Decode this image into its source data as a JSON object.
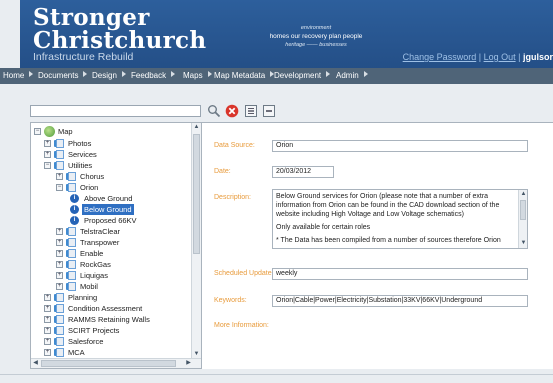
{
  "header": {
    "title_line1": "Stronger",
    "title_line2": "Christchurch",
    "subtitle": "Infrastructure Rebuild",
    "tagline_top": "environment",
    "tagline_mid": "homes  our recovery plan  people",
    "tagline_bot": "heritage —— businesses",
    "change_password": "Change Password",
    "separator": "|",
    "log_out": "Log Out",
    "user": "jgulsor"
  },
  "nav": {
    "items": [
      {
        "label": "Home"
      },
      {
        "label": "Documents"
      },
      {
        "label": "Design"
      },
      {
        "label": "Feedback"
      },
      {
        "label": "Maps"
      },
      {
        "label": "Map Metadata"
      },
      {
        "label": "Development"
      },
      {
        "label": "Admin"
      }
    ]
  },
  "toolbar": {
    "search_value": "",
    "icons": [
      "magnifier-icon",
      "clear-icon",
      "expand-all-icon",
      "collapse-all-icon"
    ]
  },
  "tree": {
    "items": [
      {
        "label": "Map",
        "expander": "−"
      },
      {
        "label": "Photos",
        "expander": "+"
      },
      {
        "label": "Services",
        "expander": "+"
      },
      {
        "label": "Utilities",
        "expander": "−"
      },
      {
        "label": "Chorus",
        "expander": "+"
      },
      {
        "label": "Orion",
        "expander": "−"
      },
      {
        "label": "Above Ground"
      },
      {
        "label": "Below Ground",
        "selected": true
      },
      {
        "label": "Proposed 66KV"
      },
      {
        "label": "TelstraClear",
        "expander": "+"
      },
      {
        "label": "Transpower",
        "expander": "+"
      },
      {
        "label": "Enable",
        "expander": "+"
      },
      {
        "label": "RockGas",
        "expander": "+"
      },
      {
        "label": "Liquigas",
        "expander": "+"
      },
      {
        "label": "Mobil",
        "expander": "+"
      },
      {
        "label": "Planning",
        "expander": "+"
      },
      {
        "label": "Condition Assessment",
        "expander": "+"
      },
      {
        "label": "RAMMS Retaining Walls",
        "expander": "+"
      },
      {
        "label": "SCIRT Projects",
        "expander": "+"
      },
      {
        "label": "Salesforce",
        "expander": "+"
      },
      {
        "label": "MCA",
        "expander": "+"
      }
    ]
  },
  "details": {
    "data_source_label": "Data Source:",
    "data_source": "Orion",
    "date_label": "Date:",
    "date": "20/03/2012",
    "description_label": "Description:",
    "description_p1": "Below Ground services for Orion (please note that a number of extra information from Orion can be found in the CAD download section of the website including High Voltage and Low Voltage schematics)",
    "description_p2": "Only available for certain roles",
    "description_p3": "* The Data has been compiled from a number of sources therefore Orion",
    "scheduled_update_label": "Scheduled Update:",
    "scheduled_update": "weekly",
    "keywords_label": "Keywords:",
    "keywords": "Orion|Cable|Power|Electricity|Substation|33KV|66KV|Underground",
    "more_info_label": "More Information:"
  },
  "colors": {
    "header_blue": "#2d5f9c",
    "nav_gray": "#4f6478",
    "label_orange": "#e89b3c",
    "selection_blue": "#2f6fc2"
  }
}
